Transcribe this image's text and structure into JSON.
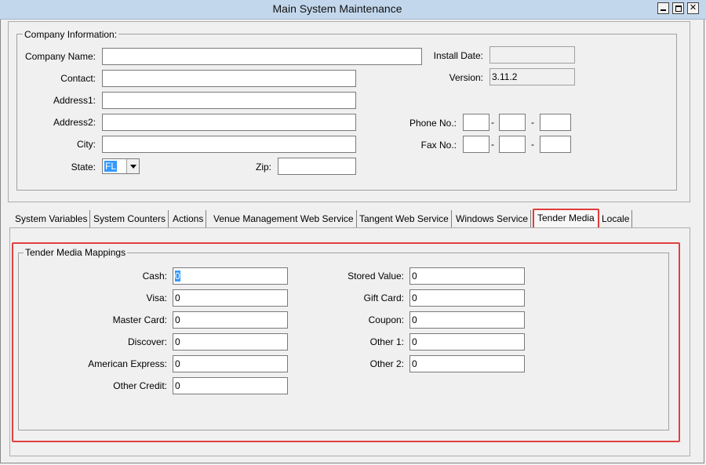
{
  "window": {
    "title": "Main System Maintenance",
    "controls": {
      "minimize": "minimize-icon",
      "maximize": "maximize-icon",
      "close": "close-icon"
    }
  },
  "company": {
    "legend": "Company Information:",
    "company_name": {
      "label": "Company Name:",
      "value": ""
    },
    "contact": {
      "label": "Contact:",
      "value": ""
    },
    "address1": {
      "label": "Address1:",
      "value": ""
    },
    "address2": {
      "label": "Address2:",
      "value": ""
    },
    "city": {
      "label": "City:",
      "value": ""
    },
    "state": {
      "label": "State:",
      "value": "FL"
    },
    "zip": {
      "label": "Zip:",
      "value": ""
    },
    "install_date": {
      "label": "Install Date:",
      "value": ""
    },
    "version": {
      "label": "Version:",
      "value": "3.11.2"
    },
    "phone": {
      "label": "Phone No.:",
      "sep": "-",
      "parts": [
        "",
        "",
        ""
      ]
    },
    "fax": {
      "label": "Fax No.:",
      "sep": "-",
      "parts": [
        "",
        "",
        ""
      ]
    }
  },
  "tabs": [
    {
      "label": "System Variables"
    },
    {
      "label": "System Counters"
    },
    {
      "label": "Actions"
    },
    {
      "label": "Venue Management Web Service"
    },
    {
      "label": "Tangent Web Service"
    },
    {
      "label": "Windows Service"
    },
    {
      "label": "Tender Media"
    },
    {
      "label": "Locale"
    }
  ],
  "active_tab": "Tender Media",
  "tender_media": {
    "legend": "Tender Media Mappings",
    "left": [
      {
        "label": "Cash:",
        "value": "0"
      },
      {
        "label": "Visa:",
        "value": "0"
      },
      {
        "label": "Master Card:",
        "value": "0"
      },
      {
        "label": "Discover:",
        "value": "0"
      },
      {
        "label": "American Express:",
        "value": "0"
      },
      {
        "label": "Other Credit:",
        "value": "0"
      }
    ],
    "right": [
      {
        "label": "Stored Value:",
        "value": "0"
      },
      {
        "label": "Gift Card:",
        "value": "0"
      },
      {
        "label": "Coupon:",
        "value": "0"
      },
      {
        "label": "Other 1:",
        "value": "0"
      },
      {
        "label": "Other 2:",
        "value": "0"
      }
    ]
  },
  "colors": {
    "highlight": "#e04040",
    "selection": "#3399ff",
    "titlebar": "#c3d7ec"
  }
}
